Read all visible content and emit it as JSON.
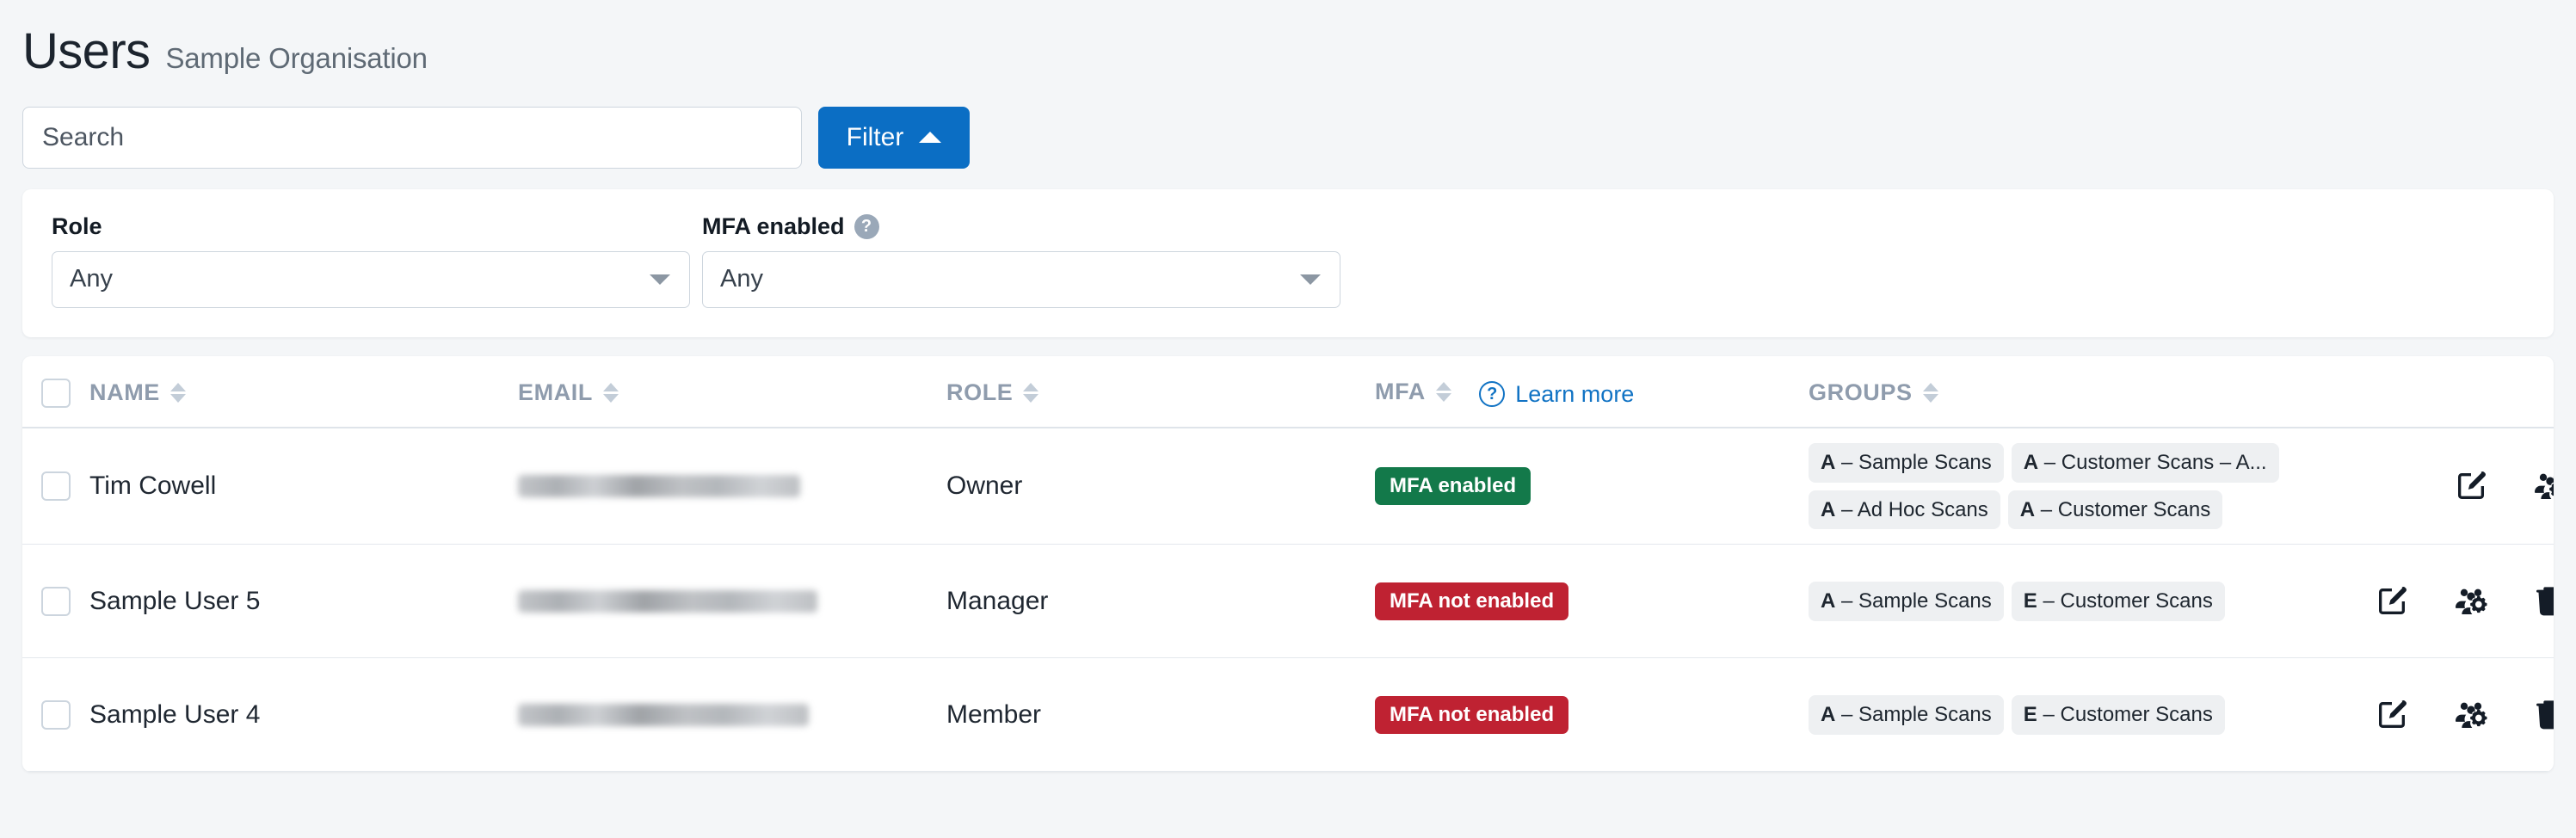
{
  "header": {
    "title": "Users",
    "subtitle": "Sample Organisation"
  },
  "search": {
    "placeholder": "Search",
    "value": ""
  },
  "filter_button": {
    "label": "Filter",
    "caret_icon": "caret-up-icon",
    "expanded": true,
    "color": "#0b6ec4"
  },
  "filter_panel": {
    "fields": [
      {
        "label": "Role",
        "value": "Any",
        "has_help": false
      },
      {
        "label": "MFA enabled",
        "value": "Any",
        "has_help": true,
        "help_icon": "help-circle-icon",
        "help_glyph": "?"
      }
    ]
  },
  "table": {
    "select_all_checkbox": "unchecked",
    "columns": [
      {
        "key": "name",
        "label": "NAME",
        "sortable": true,
        "sort_state": "asc"
      },
      {
        "key": "email",
        "label": "EMAIL",
        "sortable": true,
        "sort_state": "none"
      },
      {
        "key": "role",
        "label": "ROLE",
        "sortable": true,
        "sort_state": "none"
      },
      {
        "key": "mfa",
        "label": "MFA",
        "sortable": true,
        "sort_state": "none"
      },
      {
        "key": "groups",
        "label": "GROUPS",
        "sortable": true,
        "sort_state": "none"
      }
    ],
    "mfa_help": {
      "icon": "help-circle-outline-icon",
      "glyph": "?",
      "link_label": "Learn more",
      "color": "#1173c4"
    },
    "rows": [
      {
        "checkbox": "unchecked",
        "name": "Tim Cowell",
        "email": "",
        "email_redacted": true,
        "role": "Owner",
        "mfa": {
          "label": "MFA enabled",
          "state": "enabled",
          "color": "#13794a"
        },
        "groups": [
          {
            "prefix": "A",
            "separator": "–",
            "name": "Sample Scans"
          },
          {
            "prefix": "A",
            "separator": "–",
            "name": "Customer Scans – A..."
          },
          {
            "prefix": "A",
            "separator": "–",
            "name": "Ad Hoc Scans"
          },
          {
            "prefix": "A",
            "separator": "–",
            "name": "Customer Scans"
          }
        ],
        "actions": [
          {
            "name": "edit-user-button",
            "icon": "pencil-square-icon"
          },
          {
            "name": "manage-groups-button",
            "icon": "users-gear-icon"
          }
        ]
      },
      {
        "checkbox": "unchecked",
        "name": "Sample User 5",
        "email": "",
        "email_redacted": true,
        "role": "Manager",
        "mfa": {
          "label": "MFA not enabled",
          "state": "disabled",
          "color": "#bf2232"
        },
        "groups": [
          {
            "prefix": "A",
            "separator": "–",
            "name": "Sample Scans"
          },
          {
            "prefix": "E",
            "separator": "–",
            "name": "Customer Scans"
          }
        ],
        "actions": [
          {
            "name": "edit-user-button",
            "icon": "pencil-square-icon"
          },
          {
            "name": "manage-groups-button",
            "icon": "users-gear-icon"
          },
          {
            "name": "delete-user-button",
            "icon": "trash-icon"
          }
        ]
      },
      {
        "checkbox": "unchecked",
        "name": "Sample User 4",
        "email": "",
        "email_redacted": true,
        "role": "Member",
        "mfa": {
          "label": "MFA not enabled",
          "state": "disabled",
          "color": "#bf2232"
        },
        "groups": [
          {
            "prefix": "A",
            "separator": "–",
            "name": "Sample Scans"
          },
          {
            "prefix": "E",
            "separator": "–",
            "name": "Customer Scans"
          }
        ],
        "actions": [
          {
            "name": "edit-user-button",
            "icon": "pencil-square-icon"
          },
          {
            "name": "manage-groups-button",
            "icon": "users-gear-icon"
          },
          {
            "name": "delete-user-button",
            "icon": "trash-icon"
          }
        ]
      }
    ]
  }
}
